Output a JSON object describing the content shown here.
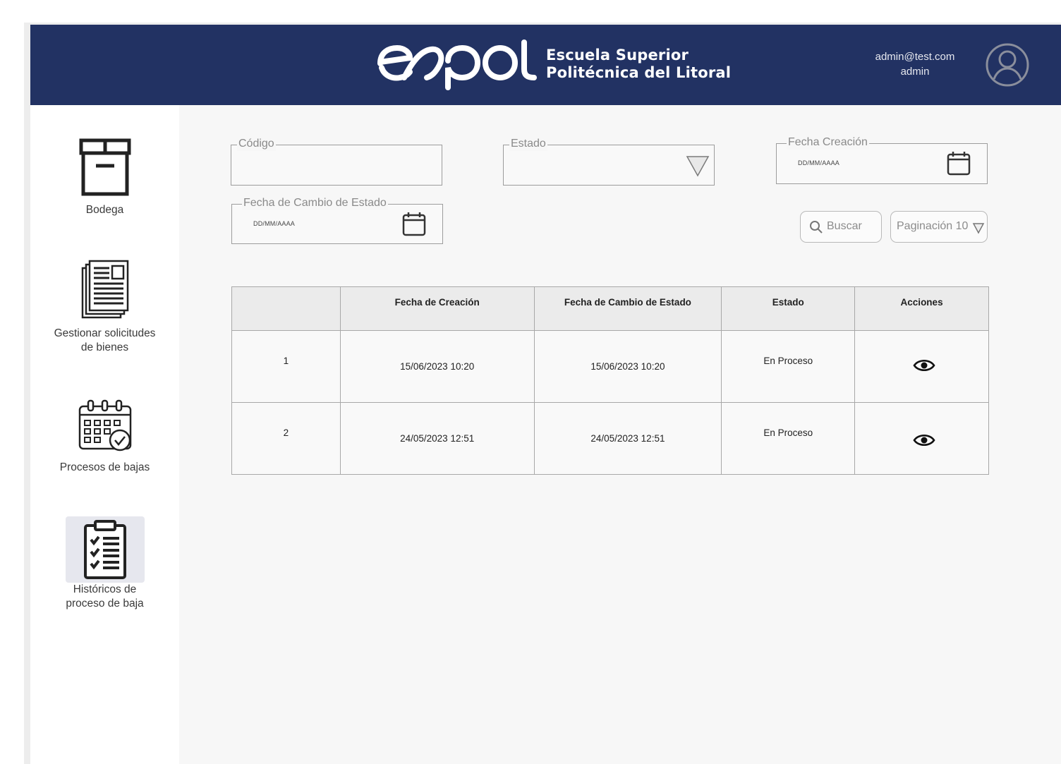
{
  "header": {
    "logo_text": "espol",
    "institution_line1": "Escuela Superior",
    "institution_line2": "Politécnica del Litoral",
    "user_email": "admin@test.com",
    "user_role": "admin",
    "avatar_icon": "user-circle-icon",
    "background_color": "#223263"
  },
  "sidebar": {
    "items": [
      {
        "label": "Bodega",
        "icon": "box-icon"
      },
      {
        "label_line1": "Gestionar solicitudes",
        "label_line2": "de bienes",
        "icon": "documents-icon"
      },
      {
        "label": "Procesos de bajas",
        "icon": "calendar-check-icon"
      },
      {
        "label_line1": "Históricos de",
        "label_line2": "proceso de baja",
        "icon": "clipboard-checklist-icon"
      }
    ]
  },
  "filters": {
    "codigo_label": "Código",
    "codigo_value": "",
    "estado_label": "Estado",
    "estado_value": "",
    "fecha_creacion_label": "Fecha Creación",
    "fecha_creacion_placeholder": "DD/MM/AAAA",
    "fecha_cambio_label": "Fecha de Cambio de Estado",
    "fecha_cambio_placeholder": "DD/MM/AAAA",
    "search_button": "Buscar",
    "pagination_label": "Paginación 10"
  },
  "table": {
    "columns": [
      "",
      "Fecha de Creación",
      "Fecha de Cambio de Estado",
      "Estado",
      "Acciones"
    ],
    "rows": [
      {
        "id": "1",
        "fecha_creacion": "15/06/2023 10:20",
        "fecha_cambio": "15/06/2023 10:20",
        "estado": "En Proceso",
        "accion_icon": "eye-icon"
      },
      {
        "id": "2",
        "fecha_creacion": "24/05/2023 12:51",
        "fecha_cambio": "24/05/2023 12:51",
        "estado": "En Proceso",
        "accion_icon": "eye-icon"
      }
    ]
  }
}
